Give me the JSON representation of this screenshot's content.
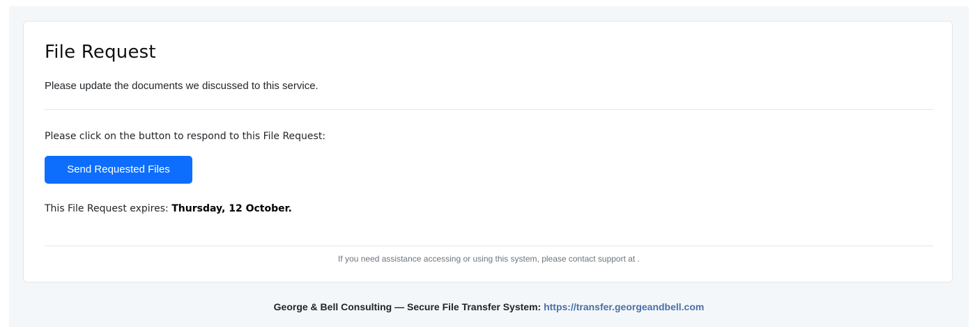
{
  "card": {
    "title": "File Request",
    "message": "Please update the documents we discussed to this service.",
    "instruction": "Please click on the button to respond to this File Request:",
    "button_label": "Send Requested Files",
    "expiry_prefix": "This File Request expires: ",
    "expiry_date": "Thursday, 12 October.",
    "support_text": "If you need assistance accessing or using this system, please contact support at ."
  },
  "footer": {
    "company_text": "George & Bell Consulting — Secure File Transfer System: ",
    "link_text": "https://transfer.georgeandbell.com"
  },
  "colors": {
    "accent": "#0d6efd",
    "link": "#4a6fa5",
    "background": "#f4f7fa"
  }
}
